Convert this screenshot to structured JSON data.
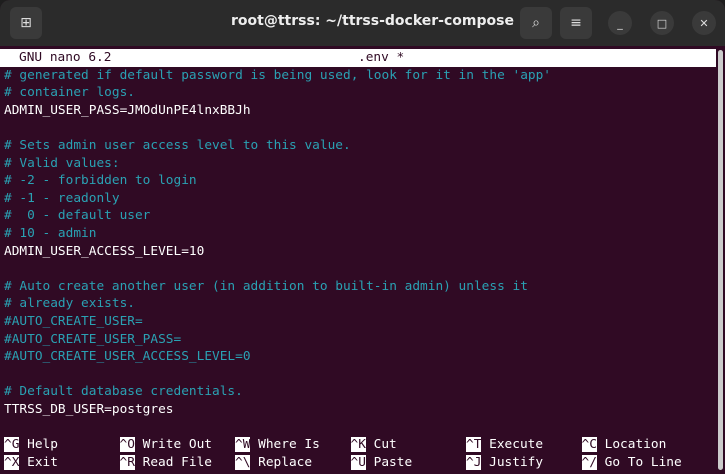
{
  "window": {
    "title": "root@ttrss: ~/ttrss-docker-compose",
    "new_tab_icon": "new-tab-icon",
    "search_icon": "search-icon",
    "menu_icon": "hamburger-icon"
  },
  "nano": {
    "version": "GNU nano 6.2",
    "filename": ".env *"
  },
  "lines": [
    {
      "text": "# generated if default password is being used, look for it in the 'app'",
      "comment": true
    },
    {
      "text": "# container logs.",
      "comment": true
    },
    {
      "text": "ADMIN_USER_PASS=JMOdUnPE4lnxBBJh",
      "comment": false
    },
    {
      "text": "",
      "comment": false
    },
    {
      "text": "# Sets admin user access level to this value.",
      "comment": true
    },
    {
      "text": "# Valid values:",
      "comment": true
    },
    {
      "text": "# -2 - forbidden to login",
      "comment": true
    },
    {
      "text": "# -1 - readonly",
      "comment": true
    },
    {
      "text": "#  0 - default user",
      "comment": true
    },
    {
      "text": "# 10 - admin",
      "comment": true
    },
    {
      "text": "ADMIN_USER_ACCESS_LEVEL=10",
      "comment": false
    },
    {
      "text": "",
      "comment": false
    },
    {
      "text": "# Auto create another user (in addition to built-in admin) unless it",
      "comment": true
    },
    {
      "text": "# already exists.",
      "comment": true
    },
    {
      "text": "#AUTO_CREATE_USER=",
      "comment": true
    },
    {
      "text": "#AUTO_CREATE_USER_PASS=",
      "comment": true
    },
    {
      "text": "#AUTO_CREATE_USER_ACCESS_LEVEL=0",
      "comment": true
    },
    {
      "text": "",
      "comment": false
    },
    {
      "text": "# Default database credentials.",
      "comment": true
    },
    {
      "text": "TTRSS_DB_USER=postgres",
      "comment": false
    }
  ],
  "shortcuts": [
    [
      {
        "key": "^G",
        "label": "Help"
      },
      {
        "key": "^O",
        "label": "Write Out"
      },
      {
        "key": "^W",
        "label": "Where Is"
      },
      {
        "key": "^K",
        "label": "Cut"
      },
      {
        "key": "^T",
        "label": "Execute"
      },
      {
        "key": "^C",
        "label": "Location"
      }
    ],
    [
      {
        "key": "^X",
        "label": "Exit"
      },
      {
        "key": "^R",
        "label": "Read File"
      },
      {
        "key": "^\\",
        "label": "Replace"
      },
      {
        "key": "^U",
        "label": "Paste"
      },
      {
        "key": "^J",
        "label": "Justify"
      },
      {
        "key": "^/",
        "label": "Go To Line"
      }
    ]
  ],
  "colors": {
    "background": "#300a24",
    "comment": "#2aa1b3"
  }
}
